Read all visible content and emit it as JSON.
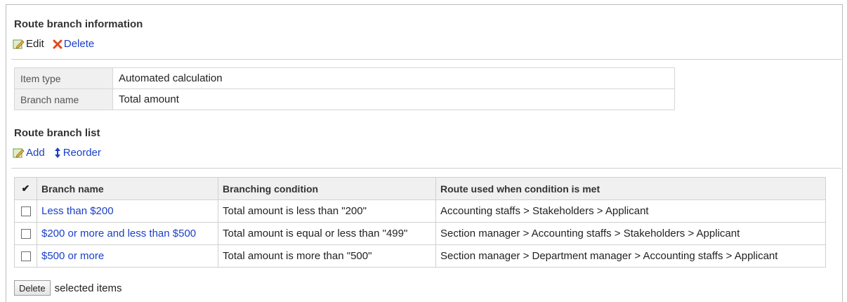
{
  "branch_info": {
    "title": "Route branch information",
    "edit_label": "Edit",
    "delete_label": "Delete",
    "rows": [
      {
        "label": "Item type",
        "value": "Automated calculation"
      },
      {
        "label": "Branch name",
        "value": "Total amount"
      }
    ]
  },
  "branch_list": {
    "title": "Route branch list",
    "add_label": "Add",
    "reorder_label": "Reorder",
    "header_check": "✔",
    "columns": [
      "Branch name",
      "Branching condition",
      "Route used when condition is met"
    ],
    "rows": [
      {
        "name": "Less than $200",
        "condition": "Total amount is less than \"200\"",
        "route": "Accounting staffs > Stakeholders > Applicant"
      },
      {
        "name": "$200 or more and less than $500",
        "condition": "Total amount is equal or less than \"499\"",
        "route": "Section manager > Accounting staffs > Stakeholders > Applicant"
      },
      {
        "name": "$500 or more",
        "condition": "Total amount is more than \"500\"",
        "route": "Section manager > Department manager > Accounting staffs > Applicant"
      }
    ]
  },
  "footer": {
    "delete_button": "Delete",
    "selected_text": "selected items"
  },
  "colors": {
    "link": "#1a3fc8",
    "delete_x": "#e04a1a",
    "header_bg": "#f0f0f0"
  }
}
